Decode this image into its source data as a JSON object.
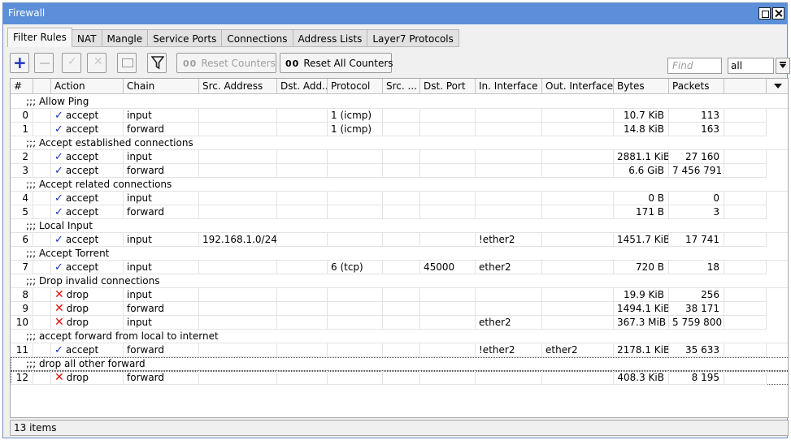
{
  "window": {
    "title": "Firewall"
  },
  "tabs": [
    "Filter Rules",
    "NAT",
    "Mangle",
    "Service Ports",
    "Connections",
    "Address Lists",
    "Layer7 Protocols"
  ],
  "toolbar": {
    "reset_counters": "Reset Counters",
    "reset_all_counters": "Reset All Counters",
    "counter_glyph": "00",
    "find_placeholder": "Find",
    "scope_value": "all"
  },
  "icons": {
    "add": "plus-icon",
    "remove": "minus-icon",
    "enable": "check-icon",
    "disable": "x-icon",
    "comment": "note-icon",
    "filter": "filter-icon",
    "accept": "checkmark-icon",
    "drop": "red-x-icon"
  },
  "colors": {
    "titlebar": "#5b8fd9",
    "accent": "#1c2fb8",
    "drop": "#e01010"
  },
  "columns": [
    "#",
    "",
    "Action",
    "Chain",
    "Src. Address",
    "Dst. Add...",
    "Protocol",
    "Src. ...",
    "Dst. Port",
    "In. Interface",
    "Out. Interface",
    "Bytes",
    "Packets"
  ],
  "rows": [
    {
      "comment": ";;; Allow Ping"
    },
    {
      "id": "0",
      "action": "accept",
      "chain": "input",
      "src": "",
      "dst": "",
      "protocol": "1 (icmp)",
      "sport": "",
      "dport": "",
      "in": "",
      "out": "",
      "bytes": "10.7 KiB",
      "packets": "113"
    },
    {
      "id": "1",
      "action": "accept",
      "chain": "forward",
      "src": "",
      "dst": "",
      "protocol": "1 (icmp)",
      "sport": "",
      "dport": "",
      "in": "",
      "out": "",
      "bytes": "14.8 KiB",
      "packets": "163"
    },
    {
      "comment": ";;; Accept established connections"
    },
    {
      "id": "2",
      "action": "accept",
      "chain": "input",
      "src": "",
      "dst": "",
      "protocol": "",
      "sport": "",
      "dport": "",
      "in": "",
      "out": "",
      "bytes": "2881.1 KiB",
      "packets": "27 160"
    },
    {
      "id": "3",
      "action": "accept",
      "chain": "forward",
      "src": "",
      "dst": "",
      "protocol": "",
      "sport": "",
      "dport": "",
      "in": "",
      "out": "",
      "bytes": "6.6 GiB",
      "packets": "7 456 791"
    },
    {
      "comment": ";;; Accept related connections"
    },
    {
      "id": "4",
      "action": "accept",
      "chain": "input",
      "src": "",
      "dst": "",
      "protocol": "",
      "sport": "",
      "dport": "",
      "in": "",
      "out": "",
      "bytes": "0 B",
      "packets": "0"
    },
    {
      "id": "5",
      "action": "accept",
      "chain": "forward",
      "src": "",
      "dst": "",
      "protocol": "",
      "sport": "",
      "dport": "",
      "in": "",
      "out": "",
      "bytes": "171 B",
      "packets": "3"
    },
    {
      "comment": ";;; Local Input"
    },
    {
      "id": "6",
      "action": "accept",
      "chain": "input",
      "src": "192.168.1.0/24",
      "dst": "",
      "protocol": "",
      "sport": "",
      "dport": "",
      "in": "!ether2",
      "out": "",
      "bytes": "1451.7 KiB",
      "packets": "17 741"
    },
    {
      "comment": ";;; Accept Torrent"
    },
    {
      "id": "7",
      "action": "accept",
      "chain": "input",
      "src": "",
      "dst": "",
      "protocol": "6 (tcp)",
      "sport": "",
      "dport": "45000",
      "in": "ether2",
      "out": "",
      "bytes": "720 B",
      "packets": "18"
    },
    {
      "comment": ";;; Drop invalid connections"
    },
    {
      "id": "8",
      "action": "drop",
      "chain": "input",
      "src": "",
      "dst": "",
      "protocol": "",
      "sport": "",
      "dport": "",
      "in": "",
      "out": "",
      "bytes": "19.9 KiB",
      "packets": "256"
    },
    {
      "id": "9",
      "action": "drop",
      "chain": "forward",
      "src": "",
      "dst": "",
      "protocol": "",
      "sport": "",
      "dport": "",
      "in": "",
      "out": "",
      "bytes": "1494.1 KiB",
      "packets": "38 171"
    },
    {
      "id": "10",
      "action": "drop",
      "chain": "input",
      "src": "",
      "dst": "",
      "protocol": "",
      "sport": "",
      "dport": "",
      "in": "ether2",
      "out": "",
      "bytes": "367.3 MiB",
      "packets": "5 759 800"
    },
    {
      "comment": ";;; accept forward from local to internet"
    },
    {
      "id": "11",
      "action": "accept",
      "chain": "forward",
      "src": "",
      "dst": "",
      "protocol": "",
      "sport": "",
      "dport": "",
      "in": "!ether2",
      "out": "ether2",
      "bytes": "2178.1 KiB",
      "packets": "35 633"
    },
    {
      "comment": ";;; drop all other forward",
      "focused": true
    },
    {
      "id": "12",
      "action": "drop",
      "chain": "forward",
      "src": "",
      "dst": "",
      "protocol": "",
      "sport": "",
      "dport": "",
      "in": "",
      "out": "",
      "bytes": "408.3 KiB",
      "packets": "8 195",
      "focused": true
    }
  ],
  "status": {
    "items": "13 items"
  }
}
